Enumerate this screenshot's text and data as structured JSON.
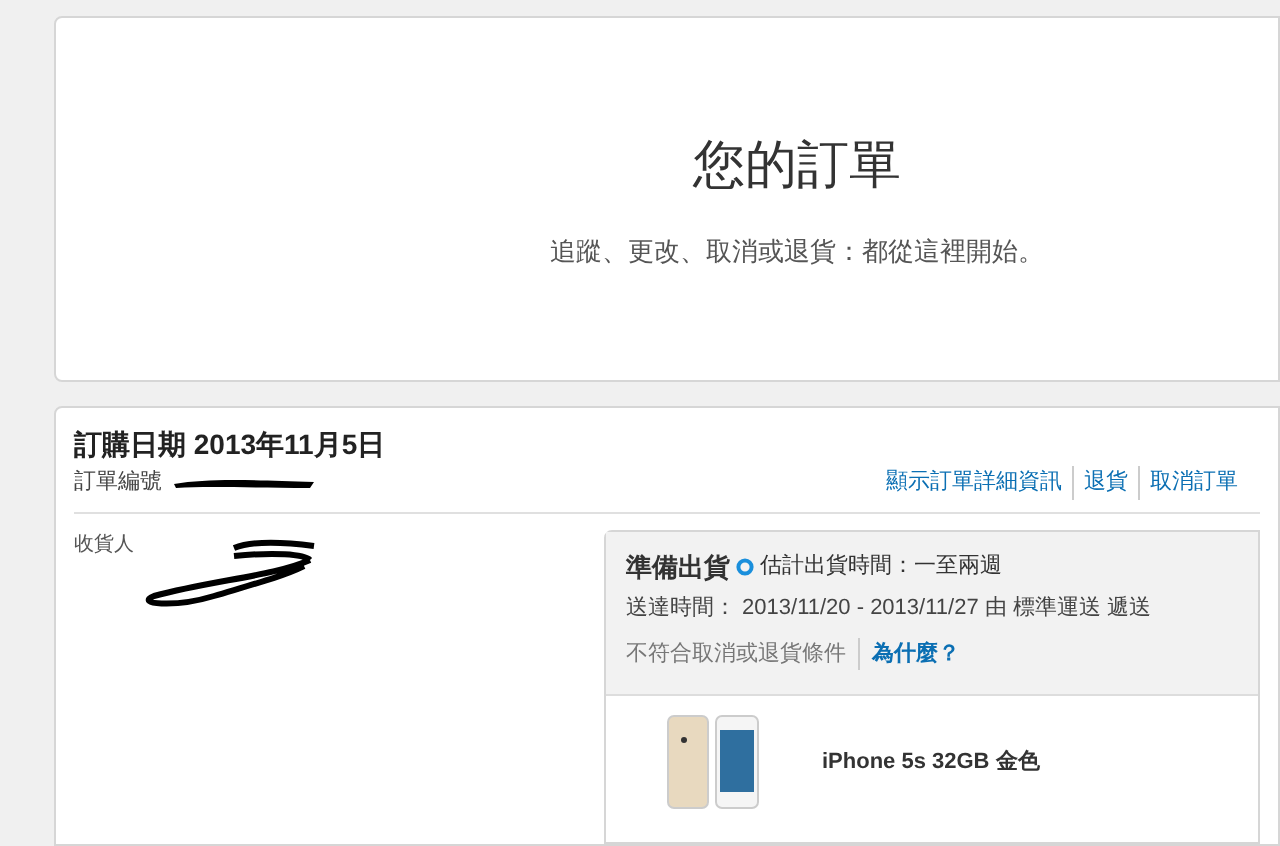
{
  "hero": {
    "title": "您的訂單",
    "subtitle": "追蹤、更改、取消或退貨：都從這裡開始。"
  },
  "order": {
    "date_label": "訂購日期 2013年11月5日",
    "number_label": "訂單編號",
    "links": [
      "顯示訂單詳細資訊",
      "退貨",
      "取消訂單"
    ],
    "recipient_label": "收貨人",
    "shipment": {
      "status": "準備出貨",
      "estimate": "估計出貨時間：一至兩週",
      "delivery": "送達時間： 2013/11/20 - 2013/11/27 由 標準運送 遞送",
      "note": "不符合取消或退貨條件",
      "why_link": "為什麼？"
    },
    "items": [
      {
        "name": "iPhone 5s 32GB 金色"
      }
    ]
  }
}
